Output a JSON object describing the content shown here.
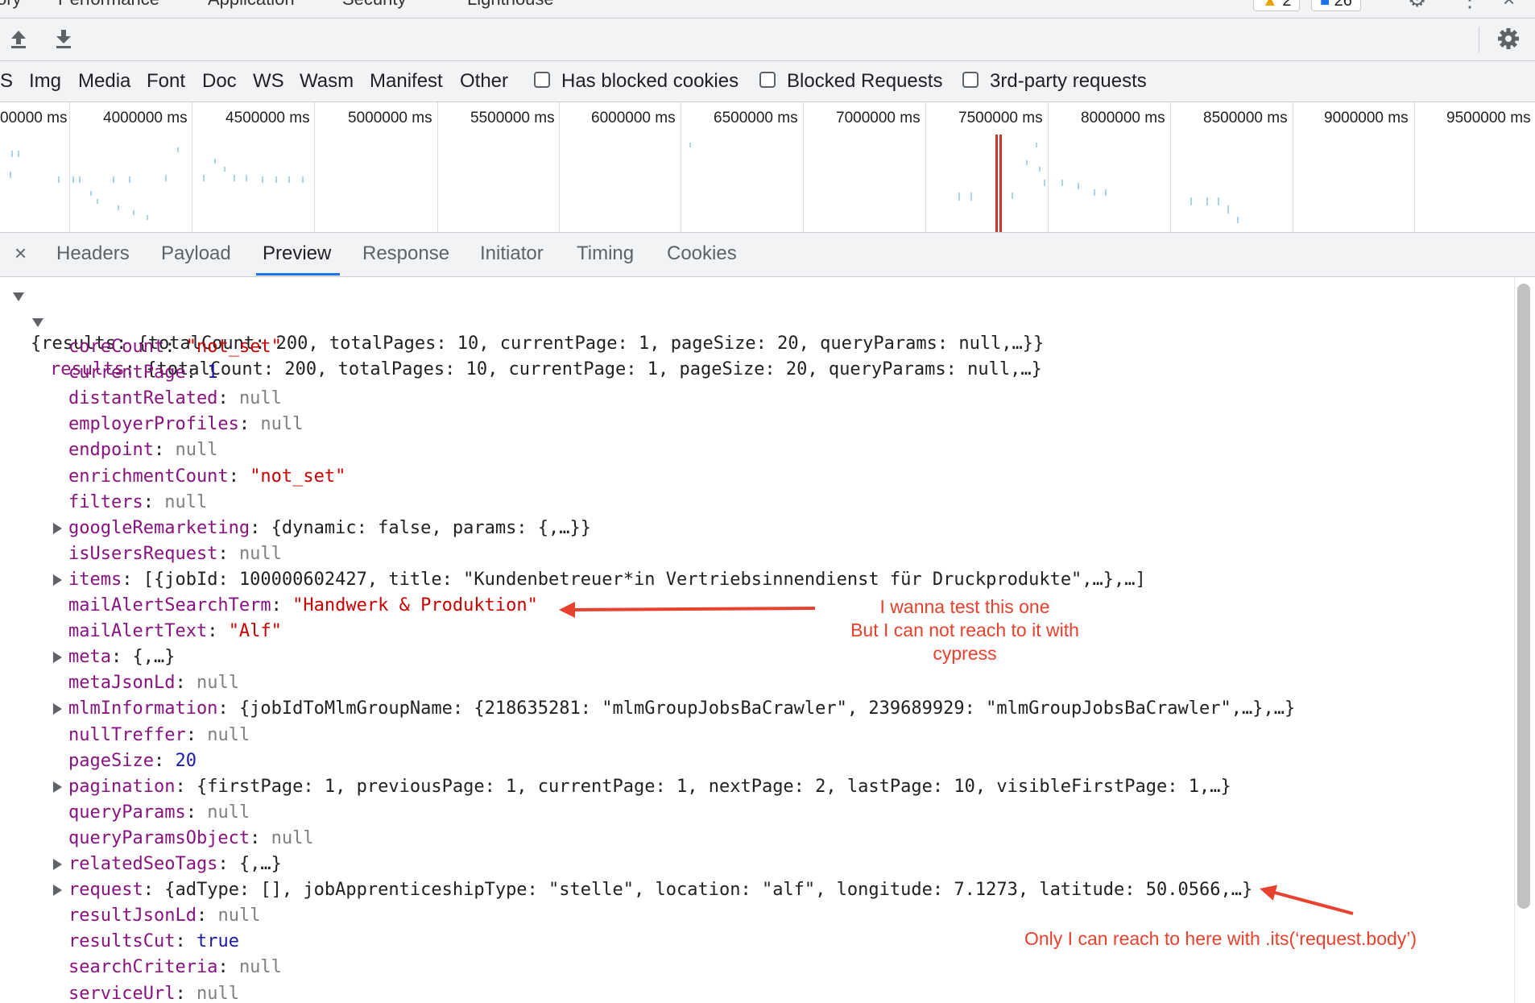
{
  "top_tabs": [
    "ory",
    "Performance",
    "Application",
    "Security",
    "Lighthouse"
  ],
  "top_badges": {
    "warnings": "2",
    "messages": "26"
  },
  "toolbar": {
    "upload_icon": "upload-icon",
    "download_icon": "download-icon",
    "settings_icon": "gear-icon"
  },
  "filters": {
    "types": [
      "S",
      "Img",
      "Media",
      "Font",
      "Doc",
      "WS",
      "Wasm",
      "Manifest",
      "Other"
    ],
    "checkboxes": [
      {
        "label": "Has blocked cookies",
        "checked": false
      },
      {
        "label": "Blocked Requests",
        "checked": false
      },
      {
        "label": "3rd-party requests",
        "checked": false
      }
    ]
  },
  "timeline": {
    "ticks": [
      "00000 ms",
      "4000000 ms",
      "4500000 ms",
      "5000000 ms",
      "5500000 ms",
      "6000000 ms",
      "6500000 ms",
      "7000000 ms",
      "7500000 ms",
      "8000000 ms",
      "8500000 ms",
      "9000000 ms",
      "9500000 ms"
    ]
  },
  "details": {
    "close_label": "×",
    "tabs": [
      "Headers",
      "Payload",
      "Preview",
      "Response",
      "Initiator",
      "Timing",
      "Cookies"
    ],
    "active_tab": "Preview"
  },
  "preview": {
    "root_summary": "{results: {totalCount: 200, totalPages: 10, currentPage: 1, pageSize: 20, queryParams: null,…}}",
    "results_key": "results",
    "results_summary": "{totalCount: 200, totalPages: 10, currentPage: 1, pageSize: 20, queryParams: null,…}",
    "properties": [
      {
        "key": "coreCount",
        "value": "\"not_set\"",
        "type": "str",
        "expandable": false
      },
      {
        "key": "currentPage",
        "value": "1",
        "type": "num",
        "expandable": false
      },
      {
        "key": "distantRelated",
        "value": "null",
        "type": "nul",
        "expandable": false
      },
      {
        "key": "employerProfiles",
        "value": "null",
        "type": "nul",
        "expandable": false
      },
      {
        "key": "endpoint",
        "value": "null",
        "type": "nul",
        "expandable": false
      },
      {
        "key": "enrichmentCount",
        "value": "\"not_set\"",
        "type": "str",
        "expandable": false
      },
      {
        "key": "filters",
        "value": "null",
        "type": "nul",
        "expandable": false
      },
      {
        "key": "googleRemarketing",
        "value": "{dynamic: false, params: {,…}}",
        "type": "obj",
        "expandable": true
      },
      {
        "key": "isUsersRequest",
        "value": "null",
        "type": "nul",
        "expandable": false
      },
      {
        "key": "items",
        "value": "[{jobId: 100000602427, title: \"Kundenbetreuer*in Vertriebsinnendienst für Druckprodukte\",…},…]",
        "type": "obj",
        "expandable": true
      },
      {
        "key": "mailAlertSearchTerm",
        "value": "\"Handwerk & Produktion\"",
        "type": "str",
        "expandable": false
      },
      {
        "key": "mailAlertText",
        "value": "\"Alf\"",
        "type": "str",
        "expandable": false
      },
      {
        "key": "meta",
        "value": "{,…}",
        "type": "obj",
        "expandable": true
      },
      {
        "key": "metaJsonLd",
        "value": "null",
        "type": "nul",
        "expandable": false
      },
      {
        "key": "mlmInformation",
        "value": "{jobIdToMlmGroupName: {218635281: \"mlmGroupJobsBaCrawler\", 239689929: \"mlmGroupJobsBaCrawler\",…},…}",
        "type": "obj",
        "expandable": true
      },
      {
        "key": "nullTreffer",
        "value": "null",
        "type": "nul",
        "expandable": false
      },
      {
        "key": "pageSize",
        "value": "20",
        "type": "num",
        "expandable": false
      },
      {
        "key": "pagination",
        "value": "{firstPage: 1, previousPage: 1, currentPage: 1, nextPage: 2, lastPage: 10, visibleFirstPage: 1,…}",
        "type": "obj",
        "expandable": true
      },
      {
        "key": "queryParams",
        "value": "null",
        "type": "nul",
        "expandable": false
      },
      {
        "key": "queryParamsObject",
        "value": "null",
        "type": "nul",
        "expandable": false
      },
      {
        "key": "relatedSeoTags",
        "value": "{,…}",
        "type": "obj",
        "expandable": true
      },
      {
        "key": "request",
        "value": "{adType: [], jobApprenticeshipType: \"stelle\", location: \"alf\", longitude: 7.1273, latitude: 50.0566,…}",
        "type": "obj",
        "expandable": true
      },
      {
        "key": "resultJsonLd",
        "value": "null",
        "type": "nul",
        "expandable": false
      },
      {
        "key": "resultsCut",
        "value": "true",
        "type": "bool",
        "expandable": false
      },
      {
        "key": "searchCriteria",
        "value": "null",
        "type": "nul",
        "expandable": false
      },
      {
        "key": "serviceUrl",
        "value": "null",
        "type": "nul",
        "expandable": false
      }
    ]
  },
  "annotations": {
    "note1_line1": "I wanna test this one",
    "note1_line2": "But I can not reach to it with",
    "note1_line3": "cypress",
    "note2": "Only I can reach to here with .its(‘request.body’)",
    "color": "#e8412d"
  }
}
